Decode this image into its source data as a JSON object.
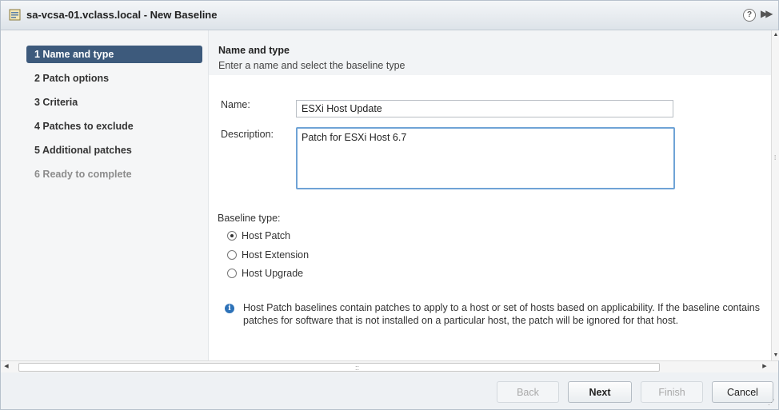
{
  "window": {
    "title": "sa-vcsa-01.vclass.local - New Baseline",
    "icons": {
      "title": "baseline-icon",
      "help": "help-icon",
      "expand": "expand-icon"
    }
  },
  "nav": {
    "items": [
      {
        "label": "1 Name and type",
        "state": "active"
      },
      {
        "label": "2 Patch options",
        "state": "enabled"
      },
      {
        "label": "3 Criteria",
        "state": "enabled"
      },
      {
        "label": "4 Patches to exclude",
        "state": "enabled"
      },
      {
        "label": "5 Additional patches",
        "state": "enabled"
      },
      {
        "label": "6 Ready to complete",
        "state": "disabled"
      }
    ]
  },
  "page": {
    "title": "Name and type",
    "subtitle": "Enter a name and select the baseline type"
  },
  "form": {
    "name_label": "Name:",
    "name_value": "ESXi Host Update",
    "description_label": "Description:",
    "description_value": "Patch for ESXi Host 6.7",
    "baseline_type_label": "Baseline type:",
    "baseline_types": [
      {
        "label": "Host Patch",
        "checked": true
      },
      {
        "label": "Host Extension",
        "checked": false
      },
      {
        "label": "Host Upgrade",
        "checked": false
      }
    ],
    "info_text": "Host Patch baselines contain patches to apply to a host or set of hosts based on applicability. If the baseline contains patches for software that is not installed on a particular host, the patch will be ignored for that host."
  },
  "footer": {
    "back_label": "Back",
    "next_label": "Next",
    "finish_label": "Finish",
    "cancel_label": "Cancel"
  },
  "colors": {
    "active_nav": "#3d5a7c",
    "focus_border": "#6fa3d6",
    "info_icon": "#2d72b8"
  }
}
